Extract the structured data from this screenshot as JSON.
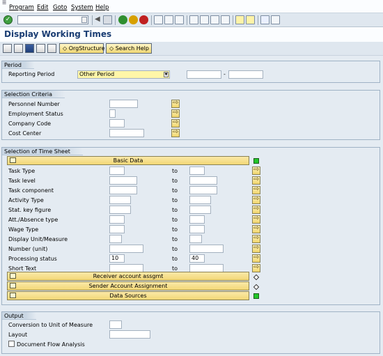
{
  "menu": {
    "items": [
      "Program",
      "Edit",
      "Goto",
      "System",
      "Help"
    ]
  },
  "title": "Display Working Times",
  "toolbar": {
    "orgstructure_label": "OrgStructure",
    "search_help_label": "Search Help"
  },
  "period": {
    "section_title": "Period",
    "reporting_period_label": "Reporting Period",
    "reporting_period_value": "Other Period",
    "dash": "-"
  },
  "selection_criteria": {
    "section_title": "Selection Criteria",
    "fields": [
      {
        "label": "Personnel Number",
        "value": ""
      },
      {
        "label": "Employment Status",
        "value": ""
      },
      {
        "label": "Company Code",
        "value": ""
      },
      {
        "label": "Cost Center",
        "value": ""
      }
    ]
  },
  "time_sheet": {
    "section_title": "Selection of Time Sheet",
    "basic_data_label": "Basic Data",
    "to_label": "to",
    "rows": [
      {
        "label": "Task Type",
        "from": "",
        "to": ""
      },
      {
        "label": "Task level",
        "from": "",
        "to": ""
      },
      {
        "label": "Task component",
        "from": "",
        "to": ""
      },
      {
        "label": "Activity Type",
        "from": "",
        "to": ""
      },
      {
        "label": "Stat. key figure",
        "from": "",
        "to": ""
      },
      {
        "label": "Att./Absence type",
        "from": "",
        "to": ""
      },
      {
        "label": "Wage Type",
        "from": "",
        "to": ""
      },
      {
        "label": "Display Unit/Measure",
        "from": "",
        "to": ""
      },
      {
        "label": "Number (unit)",
        "from": "",
        "to": ""
      },
      {
        "label": "Processing status",
        "from": "10",
        "to": "40"
      },
      {
        "label": "Short Text",
        "from": "",
        "to": ""
      }
    ],
    "blocks": [
      "Receiver account assgmt",
      "Sender Account Assignment",
      "Data Sources"
    ]
  },
  "output": {
    "section_title": "Output",
    "conversion_label": "Conversion to Unit of Measure",
    "conversion_value": "",
    "layout_label": "Layout",
    "layout_value": "",
    "doc_flow_label": "Document Flow Analysis",
    "doc_flow_checked": false
  },
  "colors": {
    "accent": "#1a3d73",
    "button": "#f0d772",
    "led_green": "#22c62a"
  }
}
